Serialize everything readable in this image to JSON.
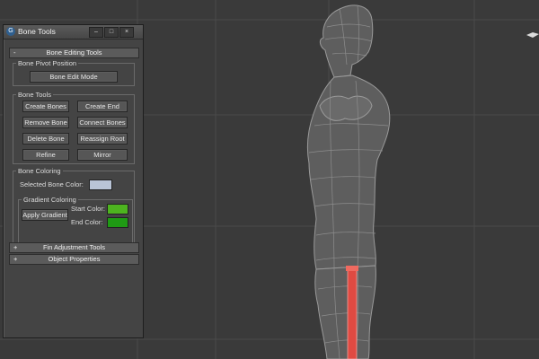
{
  "window": {
    "title": "Bone Tools",
    "icon_label": "G",
    "buttons": {
      "minimize": "–",
      "maximize": "□",
      "close": "×"
    }
  },
  "rollouts": {
    "bone_editing": {
      "sign": "-",
      "title": "Bone Editing Tools"
    },
    "fin_adjustment": {
      "sign": "+",
      "title": "Fin Adjustment Tools"
    },
    "object_properties": {
      "sign": "+",
      "title": "Object Properties"
    }
  },
  "bone_pivot": {
    "group_label": "Bone Pivot Position",
    "edit_mode_button": "Bone Edit Mode"
  },
  "bone_tools": {
    "group_label": "Bone Tools",
    "buttons": {
      "create_bones": "Create Bones",
      "create_end": "Create End",
      "remove_bone": "Remove Bone",
      "connect_bones": "Connect Bones",
      "delete_bone": "Delete Bone",
      "reassign_root": "Reassign Root",
      "refine": "Refine",
      "mirror": "Mirror"
    }
  },
  "bone_coloring": {
    "group_label": "Bone Coloring",
    "selected_color_label": "Selected Bone Color:",
    "selected_color": "#b9c4d6",
    "gradient": {
      "group_label": "Gradient Coloring",
      "apply_button": "Apply Gradient",
      "start_label": "Start Color:",
      "start_color": "#4db31f",
      "end_label": "End Color:",
      "end_color": "#1f9a14"
    }
  },
  "colors": {
    "viewport_bg": "#3a3a3a",
    "grid_line": "#4a4a4a",
    "mesh_wire": "#9a9a9a",
    "mesh_fill": "#5e5e5e",
    "bone_highlight": "#e04a42"
  }
}
